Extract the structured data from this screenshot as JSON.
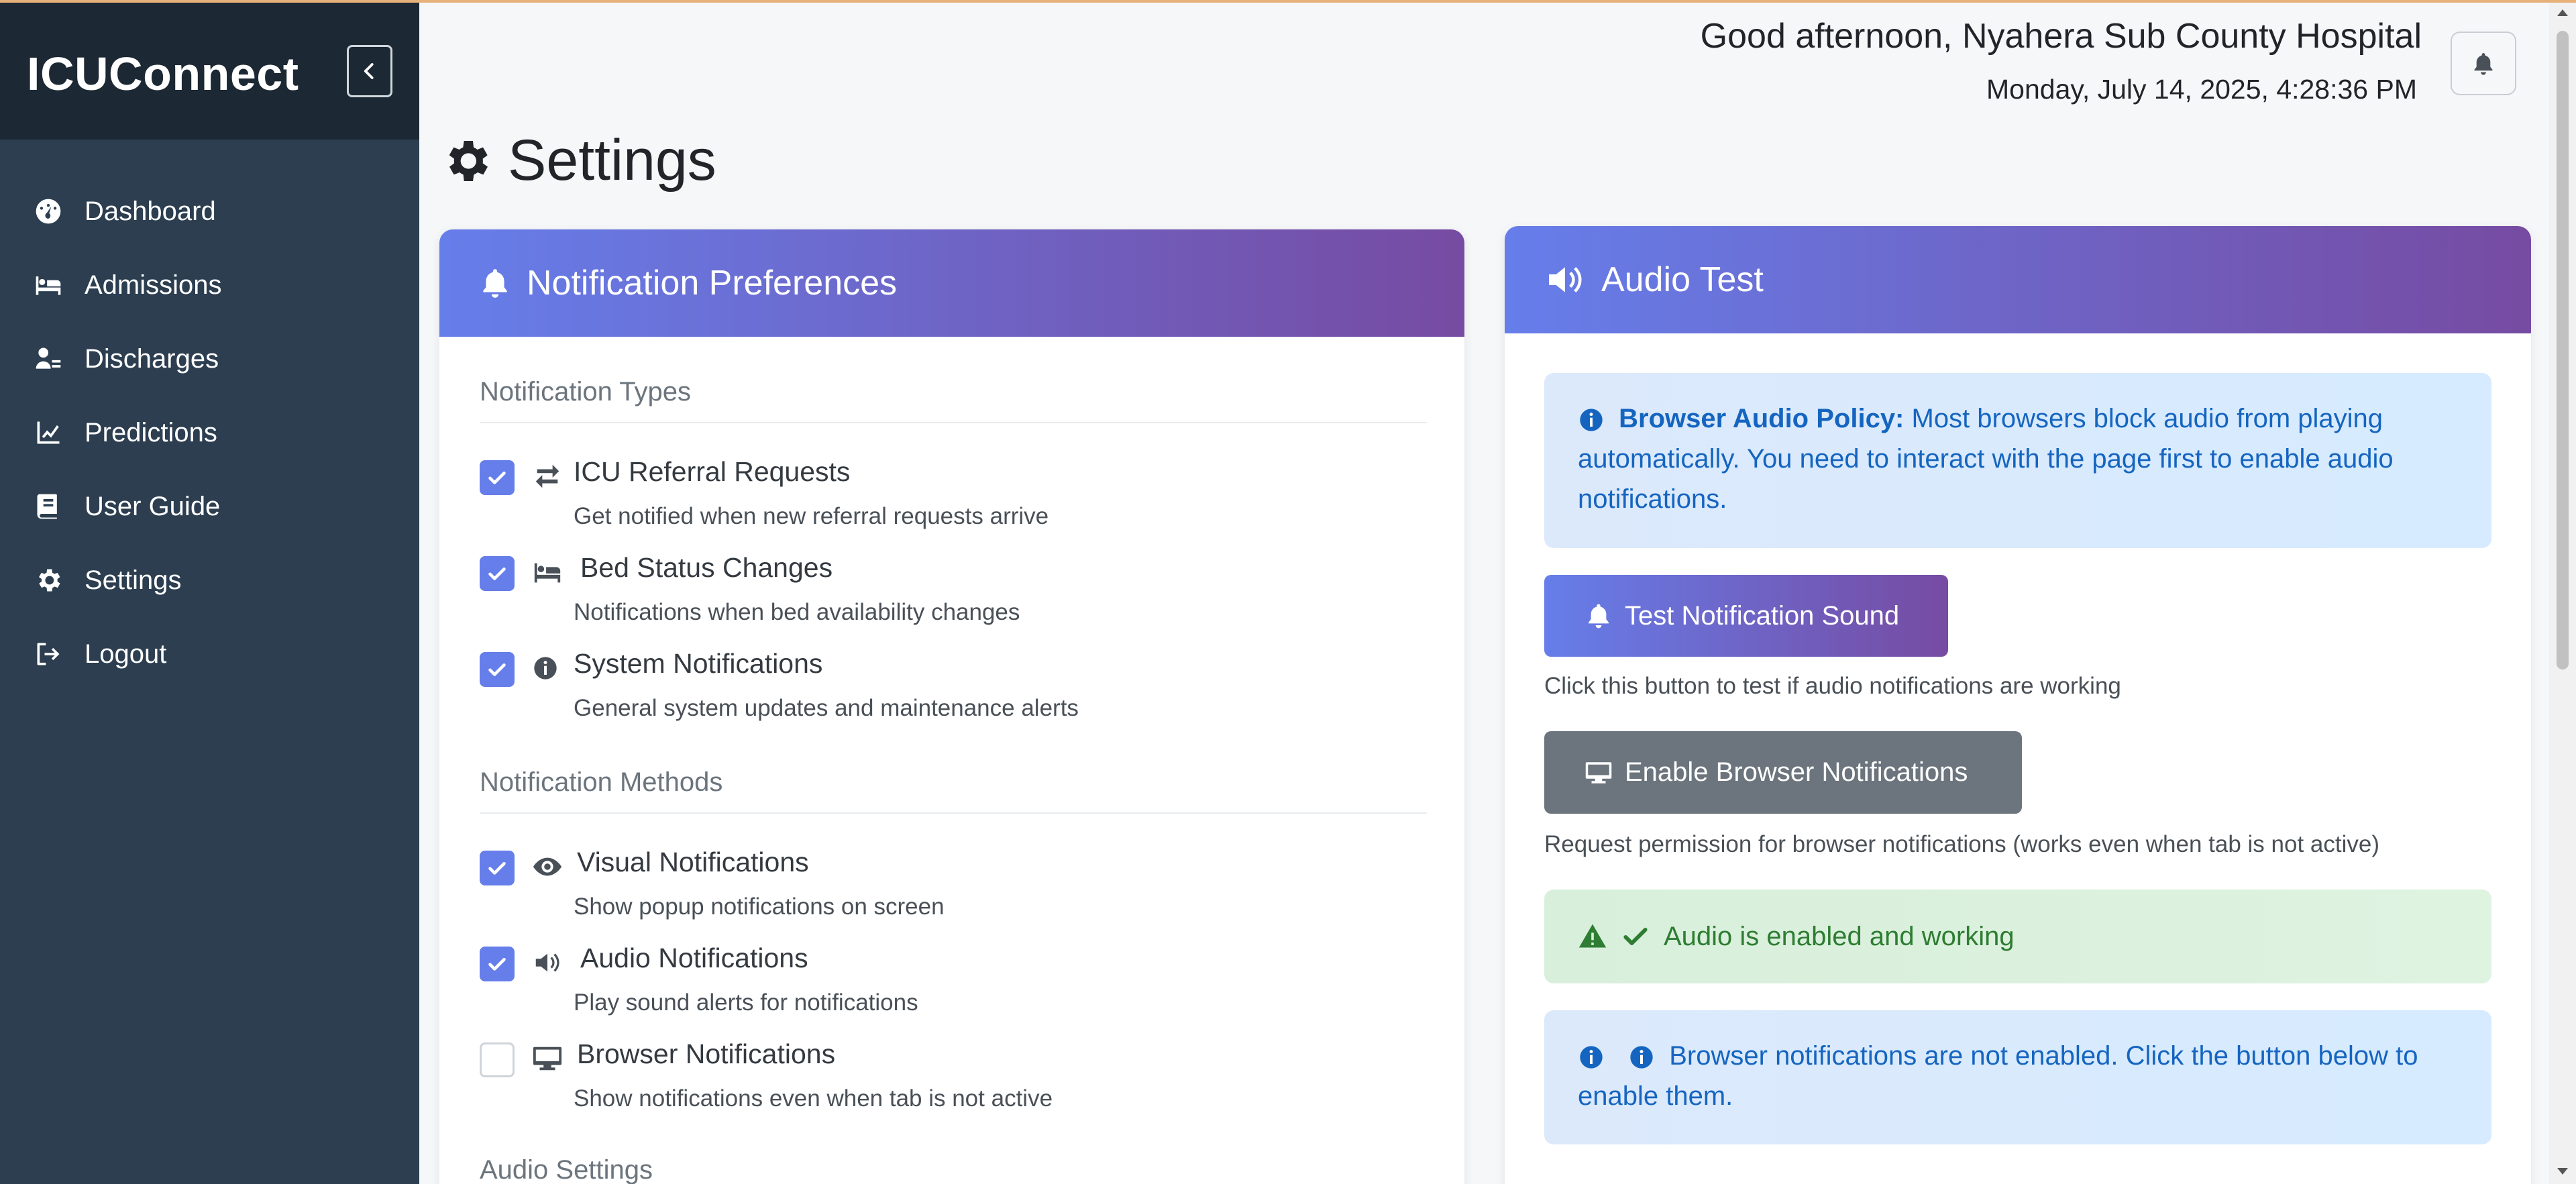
{
  "sidebar": {
    "brand": "ICUConnect",
    "items": [
      {
        "label": "Dashboard",
        "icon": "dashboard-gauge-icon"
      },
      {
        "label": "Admissions",
        "icon": "bed-patient-icon"
      },
      {
        "label": "Discharges",
        "icon": "user-discharge-icon"
      },
      {
        "label": "Predictions",
        "icon": "line-chart-icon"
      },
      {
        "label": "User Guide",
        "icon": "book-icon"
      },
      {
        "label": "Settings",
        "icon": "gear-icon"
      },
      {
        "label": "Logout",
        "icon": "sign-out-icon"
      }
    ]
  },
  "header": {
    "greeting": "Good afternoon, Nyahera Sub County Hospital",
    "datetime": "Monday, July 14, 2025, 4:28:36 PM"
  },
  "page": {
    "title": "Settings"
  },
  "notifications": {
    "title": "Notification Preferences",
    "types_title": "Notification Types",
    "types": [
      {
        "label": "ICU Referral Requests",
        "desc": "Get notified when new referral requests arrive",
        "checked": true,
        "icon": "exchange-arrows-icon"
      },
      {
        "label": "Bed Status Changes",
        "desc": "Notifications when bed availability changes",
        "checked": true,
        "icon": "bed-icon"
      },
      {
        "label": "System Notifications",
        "desc": "General system updates and maintenance alerts",
        "checked": true,
        "icon": "info-circle-icon"
      }
    ],
    "methods_title": "Notification Methods",
    "methods": [
      {
        "label": "Visual Notifications",
        "desc": "Show popup notifications on screen",
        "checked": true,
        "icon": "eye-icon"
      },
      {
        "label": "Audio Notifications",
        "desc": "Play sound alerts for notifications",
        "checked": true,
        "icon": "volume-icon"
      },
      {
        "label": "Browser Notifications",
        "desc": "Show notifications even when tab is not active",
        "checked": false,
        "icon": "desktop-icon"
      }
    ],
    "audio_title": "Audio Settings"
  },
  "audio_test": {
    "title": "Audio Test",
    "policy_bold": "Browser Audio Policy:",
    "policy_text": " Most browsers block audio from playing automatically. You need to interact with the page first to enable audio notifications.",
    "test_button": "Test Notification Sound",
    "test_helper": "Click this button to test if audio notifications are working",
    "enable_button": "Enable Browser Notifications",
    "enable_helper": "Request permission for browser notifications (works even when tab is not active)",
    "status_success": "Audio is enabled and working",
    "status_info": "Browser notifications are not enabled. Click the button below to enable them."
  },
  "colors": {
    "sidebar_bg": "#2c3e50",
    "gradient_start": "#667eea",
    "gradient_end": "#764ba2",
    "info_text": "#1565c0",
    "success_text": "#2e7d32"
  }
}
